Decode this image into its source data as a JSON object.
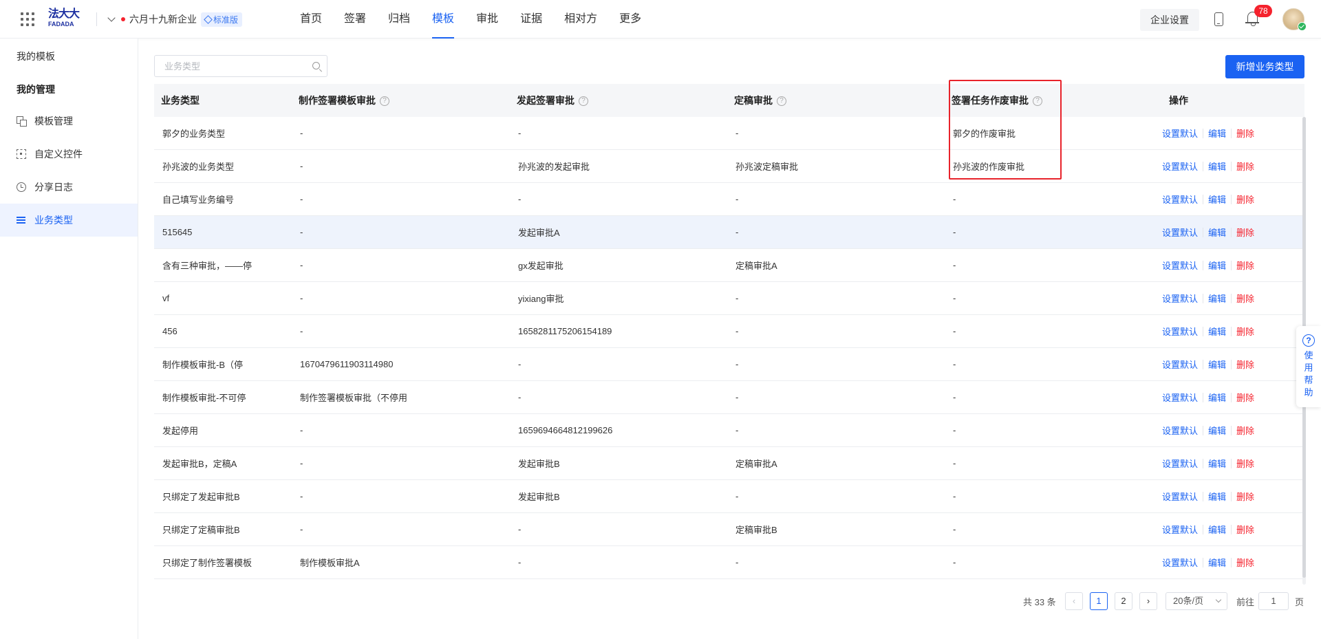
{
  "header": {
    "logo_cn": "法大大",
    "logo_en": "FADADA",
    "company": "六月十九新企业",
    "edition_badge": "标准版",
    "nav": [
      "首页",
      "签署",
      "归档",
      "模板",
      "审批",
      "证据",
      "相对方",
      "更多"
    ],
    "active_nav": "模板",
    "settings_label": "企业设置",
    "notification_count": "78"
  },
  "sidebar": {
    "my_templates": "我的模板",
    "my_management": "我的管理",
    "items": [
      {
        "label": "模板管理",
        "icon": "template-icon"
      },
      {
        "label": "自定义控件",
        "icon": "custom-control-icon"
      },
      {
        "label": "分享日志",
        "icon": "clock-icon"
      },
      {
        "label": "业务类型",
        "icon": "list-icon"
      }
    ],
    "active_item": "业务类型"
  },
  "toolbar": {
    "search_placeholder": "业务类型",
    "add_button": "新增业务类型"
  },
  "table": {
    "headers": [
      "业务类型",
      "制作签署模板审批",
      "发起签署审批",
      "定稿审批",
      "签署任务作废审批",
      "操作"
    ],
    "header_help": "?",
    "actions": {
      "set_default": "设置默认",
      "edit": "编辑",
      "delete": "删除"
    },
    "rows": [
      [
        "郭夕的业务类型",
        "-",
        "-",
        "-",
        "郭夕的作废审批"
      ],
      [
        "孙兆波的业务类型",
        "-",
        "孙兆波的发起审批",
        "孙兆波定稿审批",
        "孙兆波的作废审批"
      ],
      [
        "自己填写业务编号",
        "-",
        "-",
        "-",
        "-"
      ],
      [
        "515645",
        "-",
        "发起审批A",
        "-",
        "-"
      ],
      [
        "含有三种审批，——停",
        "-",
        "gx发起审批",
        "定稿审批A",
        "-"
      ],
      [
        "vf",
        "-",
        "yixiang审批",
        "-",
        "-"
      ],
      [
        "456",
        "-",
        "1658281175206154189",
        "-",
        "-"
      ],
      [
        "制作模板审批-B（停",
        "1670479611903114980",
        "-",
        "-",
        "-"
      ],
      [
        "制作模板审批-不可停",
        "制作签署模板审批（不停用",
        "-",
        "-",
        "-"
      ],
      [
        "发起停用",
        "-",
        "1659694664812199626",
        "-",
        "-"
      ],
      [
        "发起审批B，定稿A",
        "-",
        "发起审批B",
        "定稿审批A",
        "-"
      ],
      [
        "只绑定了发起审批B",
        "-",
        "发起审批B",
        "-",
        "-"
      ],
      [
        "只绑定了定稿审批B",
        "-",
        "-",
        "定稿审批B",
        "-"
      ],
      [
        "只绑定了制作签署模板",
        "制作模板审批A",
        "-",
        "-",
        "-"
      ]
    ]
  },
  "pagination": {
    "total": "共 33 条",
    "prev": "‹",
    "pages": [
      "1",
      "2"
    ],
    "next": "›",
    "current_page": "1",
    "page_size": "20条/页",
    "goto_label": "前往",
    "goto_value": "1",
    "page_suffix": "页"
  },
  "help_float": {
    "icon": "?",
    "label": "使用帮助"
  },
  "colors": {
    "accent": "#1a62f2",
    "danger": "#f5222d",
    "highlight_box": "#e8222a"
  }
}
